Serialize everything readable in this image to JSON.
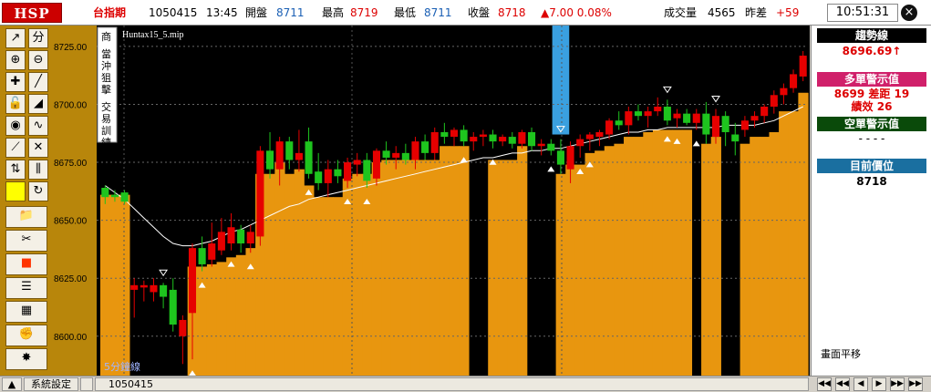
{
  "topbar": {
    "logo": "HSP",
    "market": "台指期",
    "date": "1050415",
    "time": "13:45",
    "open_label": "開盤",
    "open_value": "8711",
    "high_label": "最高",
    "high_value": "8719",
    "low_label": "最低",
    "low_value": "8711",
    "close_label": "收盤",
    "close_value": "8718",
    "change": "▲7.00 0.08%",
    "volume_label": "成交量",
    "volume_value": "4565",
    "diff_label": "昨差",
    "diff_value": "+59",
    "clock": "10:51:31",
    "close_icon": "×"
  },
  "toolbar": {
    "tools": [
      {
        "name": "draw-line-icon",
        "glyph": "↗"
      },
      {
        "name": "cursor-split-icon",
        "glyph": "分"
      },
      {
        "name": "zoom-in-icon",
        "glyph": "⊕"
      },
      {
        "name": "zoom-out-icon",
        "glyph": "⊖"
      },
      {
        "name": "crosshair-icon",
        "glyph": "✚"
      },
      {
        "name": "trend-pen-icon",
        "glyph": "╱"
      },
      {
        "name": "lock-icon",
        "glyph": "🔓"
      },
      {
        "name": "ruler-icon",
        "glyph": "◢"
      },
      {
        "name": "globe-icon",
        "glyph": "◉"
      },
      {
        "name": "wave-icon",
        "glyph": "∿"
      },
      {
        "name": "chart-tool-icon",
        "glyph": "⟋"
      },
      {
        "name": "cross-tool-icon",
        "glyph": "✕"
      },
      {
        "name": "arrows-updown-icon",
        "glyph": "⇅"
      },
      {
        "name": "bar-tool-icon",
        "glyph": "⫼"
      },
      {
        "name": "yellow-square-icon",
        "glyph": ""
      },
      {
        "name": "refresh-icon",
        "glyph": "↻"
      }
    ],
    "big_tools": [
      {
        "name": "folder-icon",
        "glyph": "📁"
      },
      {
        "name": "scissors-icon",
        "glyph": "✂"
      },
      {
        "name": "stop-square-icon",
        "glyph": "■"
      },
      {
        "name": "notepad-icon",
        "glyph": "☰"
      },
      {
        "name": "grid-icon",
        "glyph": "▦"
      },
      {
        "name": "gloves-icon",
        "glyph": "✊"
      },
      {
        "name": "burst-icon",
        "glyph": "✸"
      }
    ]
  },
  "chart": {
    "vertical_labels": [
      "商",
      "當沖狙擊",
      "交易訓練"
    ],
    "file_label": "Huntax15_5.mip",
    "bottom_label": "5分鐘線",
    "price_ticks": [
      "8725.00",
      "8700.00",
      "8675.00",
      "8650.00",
      "8625.00",
      "8600.00"
    ]
  },
  "chart_data": {
    "type": "candlestick",
    "title": "Huntax15_5.mip",
    "xlabel": "5分鐘線",
    "ylabel": "",
    "ylim": [
      8583,
      8734
    ],
    "y_ticks": [
      8725,
      8700,
      8675,
      8650,
      8625,
      8600
    ],
    "colors": {
      "up": "#e60000",
      "down": "#1ec41e",
      "fill": "#e8960f",
      "line": "#ffffff",
      "highlight": "#3aa0e0"
    },
    "candles": [
      {
        "o": 8664,
        "h": 8665,
        "l": 8657,
        "c": 8660
      },
      {
        "o": 8661,
        "h": 8663,
        "l": 8658,
        "c": 8660
      },
      {
        "o": 8662,
        "h": 8663,
        "l": 8657,
        "c": 8658
      },
      {
        "o": 8620,
        "h": 8625,
        "l": 8608,
        "c": 8622
      },
      {
        "o": 8621,
        "h": 8624,
        "l": 8615,
        "c": 8622
      },
      {
        "o": 8619,
        "h": 8625,
        "l": 8615,
        "c": 8622
      },
      {
        "o": 8622,
        "h": 8623,
        "l": 8612,
        "c": 8617
      },
      {
        "o": 8620,
        "h": 8625,
        "l": 8602,
        "c": 8605
      },
      {
        "o": 8600,
        "h": 8609,
        "l": 8588,
        "c": 8607
      },
      {
        "o": 8610,
        "h": 8640,
        "l": 8590,
        "c": 8638
      },
      {
        "o": 8638,
        "h": 8643,
        "l": 8628,
        "c": 8631
      },
      {
        "o": 8633,
        "h": 8649,
        "l": 8630,
        "c": 8640
      },
      {
        "o": 8637,
        "h": 8651,
        "l": 8635,
        "c": 8645
      },
      {
        "o": 8640,
        "h": 8653,
        "l": 8637,
        "c": 8647
      },
      {
        "o": 8646,
        "h": 8648,
        "l": 8636,
        "c": 8640
      },
      {
        "o": 8640,
        "h": 8648,
        "l": 8636,
        "c": 8645
      },
      {
        "o": 8643,
        "h": 8682,
        "l": 8639,
        "c": 8680
      },
      {
        "o": 8680,
        "h": 8688,
        "l": 8668,
        "c": 8672
      },
      {
        "o": 8672,
        "h": 8686,
        "l": 8665,
        "c": 8684
      },
      {
        "o": 8684,
        "h": 8686,
        "l": 8672,
        "c": 8676
      },
      {
        "o": 8676,
        "h": 8689,
        "l": 8671,
        "c": 8679
      },
      {
        "o": 8684,
        "h": 8690,
        "l": 8668,
        "c": 8670
      },
      {
        "o": 8671,
        "h": 8679,
        "l": 8663,
        "c": 8666
      },
      {
        "o": 8666,
        "h": 8676,
        "l": 8660,
        "c": 8672
      },
      {
        "o": 8672,
        "h": 8676,
        "l": 8666,
        "c": 8669
      },
      {
        "o": 8667,
        "h": 8677,
        "l": 8664,
        "c": 8675
      },
      {
        "o": 8674,
        "h": 8679,
        "l": 8669,
        "c": 8676
      },
      {
        "o": 8676,
        "h": 8679,
        "l": 8664,
        "c": 8667
      },
      {
        "o": 8668,
        "h": 8681,
        "l": 8665,
        "c": 8680
      },
      {
        "o": 8680,
        "h": 8684,
        "l": 8674,
        "c": 8677
      },
      {
        "o": 8677,
        "h": 8682,
        "l": 8672,
        "c": 8679
      },
      {
        "o": 8679,
        "h": 8683,
        "l": 8674,
        "c": 8676
      },
      {
        "o": 8676,
        "h": 8686,
        "l": 8672,
        "c": 8684
      },
      {
        "o": 8684,
        "h": 8687,
        "l": 8676,
        "c": 8679
      },
      {
        "o": 8679,
        "h": 8690,
        "l": 8676,
        "c": 8688
      },
      {
        "o": 8688,
        "h": 8692,
        "l": 8683,
        "c": 8686
      },
      {
        "o": 8686,
        "h": 8690,
        "l": 8682,
        "c": 8689
      },
      {
        "o": 8689,
        "h": 8691,
        "l": 8682,
        "c": 8684
      },
      {
        "o": 8684,
        "h": 8688,
        "l": 8680,
        "c": 8686
      },
      {
        "o": 8686,
        "h": 8689,
        "l": 8682,
        "c": 8687
      },
      {
        "o": 8687,
        "h": 8689,
        "l": 8681,
        "c": 8684
      },
      {
        "o": 8684,
        "h": 8687,
        "l": 8682,
        "c": 8686
      },
      {
        "o": 8686,
        "h": 8688,
        "l": 8681,
        "c": 8683
      },
      {
        "o": 8683,
        "h": 8689,
        "l": 8681,
        "c": 8688
      },
      {
        "o": 8688,
        "h": 8690,
        "l": 8680,
        "c": 8682
      },
      {
        "o": 8682,
        "h": 8685,
        "l": 8678,
        "c": 8683
      },
      {
        "o": 8683,
        "h": 8685,
        "l": 8678,
        "c": 8680
      },
      {
        "o": 8680,
        "h": 8685,
        "l": 8670,
        "c": 8674
      },
      {
        "o": 8672,
        "h": 8684,
        "l": 8666,
        "c": 8682
      },
      {
        "o": 8682,
        "h": 8687,
        "l": 8677,
        "c": 8685
      },
      {
        "o": 8685,
        "h": 8688,
        "l": 8680,
        "c": 8687
      },
      {
        "o": 8686,
        "h": 8689,
        "l": 8682,
        "c": 8688
      },
      {
        "o": 8687,
        "h": 8694,
        "l": 8685,
        "c": 8693
      },
      {
        "o": 8693,
        "h": 8697,
        "l": 8689,
        "c": 8691
      },
      {
        "o": 8691,
        "h": 8699,
        "l": 8687,
        "c": 8697
      },
      {
        "o": 8697,
        "h": 8700,
        "l": 8693,
        "c": 8695
      },
      {
        "o": 8695,
        "h": 8699,
        "l": 8690,
        "c": 8697
      },
      {
        "o": 8697,
        "h": 8703,
        "l": 8695,
        "c": 8699
      },
      {
        "o": 8699,
        "h": 8702,
        "l": 8691,
        "c": 8693
      },
      {
        "o": 8694,
        "h": 8698,
        "l": 8690,
        "c": 8696
      },
      {
        "o": 8696,
        "h": 8698,
        "l": 8691,
        "c": 8692
      },
      {
        "o": 8692,
        "h": 8698,
        "l": 8689,
        "c": 8696
      },
      {
        "o": 8696,
        "h": 8701,
        "l": 8683,
        "c": 8687
      },
      {
        "o": 8686,
        "h": 8698,
        "l": 8683,
        "c": 8695
      },
      {
        "o": 8695,
        "h": 8697,
        "l": 8682,
        "c": 8688
      },
      {
        "o": 8687,
        "h": 8692,
        "l": 8678,
        "c": 8684
      },
      {
        "o": 8689,
        "h": 8695,
        "l": 8686,
        "c": 8693
      },
      {
        "o": 8693,
        "h": 8697,
        "l": 8690,
        "c": 8695
      },
      {
        "o": 8695,
        "h": 8700,
        "l": 8692,
        "c": 8699
      },
      {
        "o": 8699,
        "h": 8706,
        "l": 8696,
        "c": 8704
      },
      {
        "o": 8704,
        "h": 8709,
        "l": 8700,
        "c": 8707
      },
      {
        "o": 8707,
        "h": 8715,
        "l": 8705,
        "c": 8713
      },
      {
        "o": 8712,
        "h": 8723,
        "l": 8710,
        "c": 8721
      }
    ],
    "ma": [
      8665,
      8662,
      8659,
      8655,
      8651,
      8647,
      8643,
      8640,
      8639,
      8639,
      8640,
      8641,
      8643,
      8645,
      8646,
      8648,
      8650,
      8652,
      8654,
      8656,
      8657,
      8659,
      8660,
      8661,
      8662,
      8663,
      8664,
      8665,
      8666,
      8667,
      8668,
      8669,
      8670,
      8671,
      8672,
      8673,
      8674,
      8675,
      8676,
      8677,
      8677,
      8678,
      8679,
      8679,
      8680,
      8680,
      8681,
      8681,
      8682,
      8683,
      8684,
      8685,
      8686,
      8687,
      8688,
      8688,
      8689,
      8689,
      8690,
      8690,
      8690,
      8690,
      8690,
      8690,
      8691,
      8691,
      8691,
      8691,
      8692,
      8693,
      8695,
      8697,
      8699
    ],
    "fill_levels": [
      8661,
      8661,
      8661,
      8583,
      8583,
      8583,
      8583,
      8583,
      8583,
      8630,
      8630,
      8631,
      8632,
      8634,
      8635,
      8638,
      8670,
      8670,
      8675,
      8670,
      8672,
      8665,
      8660,
      8660,
      8660,
      8668,
      8670,
      8670,
      8675,
      8676,
      8676,
      8676,
      8676,
      8676,
      8676,
      8682,
      8682,
      8682,
      8583,
      8583,
      8676,
      8676,
      8676,
      8682,
      8583,
      8583,
      8583,
      8670,
      8674,
      8674,
      8679,
      8680,
      8682,
      8683,
      8686,
      8686,
      8688,
      8689,
      8689,
      8689,
      8689,
      8583,
      8683,
      8686,
      8583,
      8583,
      8683,
      8686,
      8686,
      8688,
      8697,
      8697,
      8705
    ],
    "highlight_index": 47,
    "triangles_up": [
      15,
      9,
      10,
      13,
      21,
      25,
      27,
      37,
      40,
      46,
      49,
      50,
      58,
      59,
      61
    ],
    "triangles_down": [
      6,
      47,
      58,
      63
    ]
  },
  "right_panel": {
    "trend_label": "趨勢線",
    "trend_value": "8696.69↑",
    "long_label": "多單警示值",
    "long_value": "8699  差距  19",
    "long_perf": "績效  26",
    "short_label": "空單警示值",
    "short_value": "- - - -",
    "pos_label": "目前價位",
    "pos_value": "8718",
    "pan_note": "畫面平移"
  },
  "statusbar": {
    "arrow": "▲",
    "settings": "系統設定",
    "blank": "",
    "date": "1050415",
    "nav": [
      "◀◀",
      "◀◀",
      "◀",
      "▶",
      "▶▶",
      "▶▶"
    ]
  }
}
